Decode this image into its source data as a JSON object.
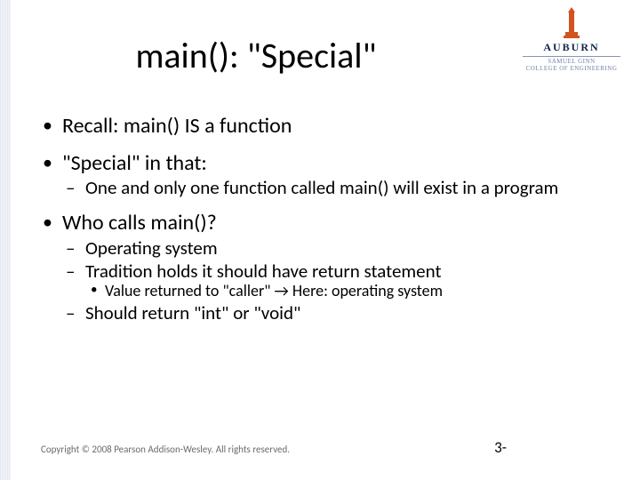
{
  "logo": {
    "name": "AUBURN",
    "subline1": "SAMUEL GINN",
    "subline2": "COLLEGE OF ENGINEERING"
  },
  "title": "main(): \"Special\"",
  "bullets": [
    {
      "text": "Recall: main() IS a function"
    },
    {
      "text": "\"Special\" in that:",
      "sub": [
        {
          "text": "One and only one function called main() will exist in a program"
        }
      ]
    },
    {
      "text": "Who calls main()?",
      "sub": [
        {
          "text": "Operating system"
        },
        {
          "text": "Tradition holds it should have return statement",
          "sub": [
            {
              "text": "Value returned to \"caller\" → Here: operating system"
            }
          ]
        },
        {
          "text": "Should return \"int\" or \"void\""
        }
      ]
    }
  ],
  "footer": {
    "copyright": "Copyright © 2008 Pearson Addison-Wesley. All rights reserved.",
    "slide_number": "3-"
  }
}
